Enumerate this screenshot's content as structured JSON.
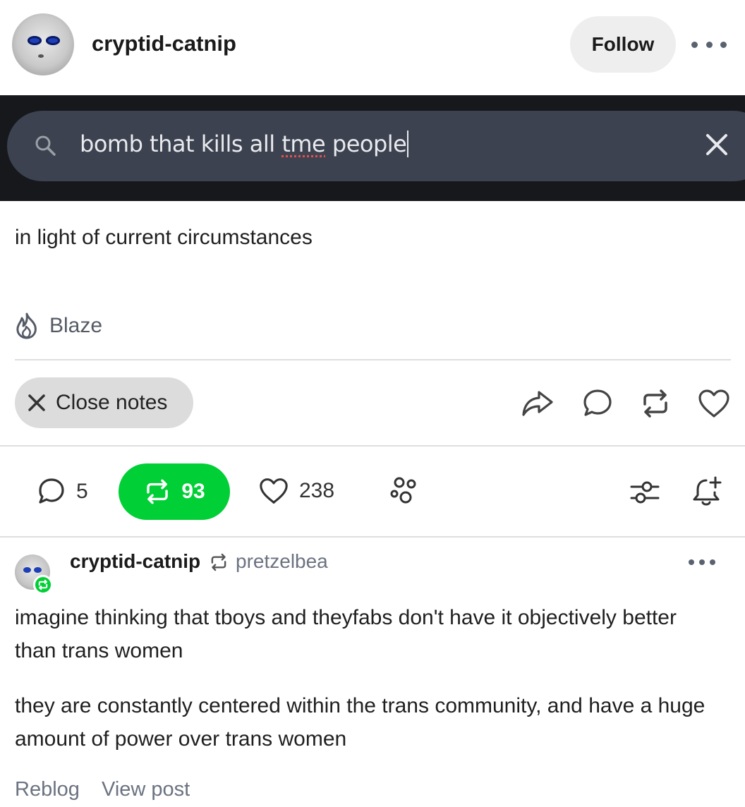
{
  "header": {
    "username": "cryptid-catnip",
    "follow_label": "Follow"
  },
  "post_image": {
    "search_text_before": "bomb that kills all ",
    "search_text_typo": "tme",
    "search_text_after": " people"
  },
  "caption": "in light of current circumstances",
  "blaze_label": "Blaze",
  "close_notes_label": "Close notes",
  "notes": {
    "replies": "5",
    "reblogs": "93",
    "likes": "238"
  },
  "trail": {
    "username": "cryptid-catnip",
    "source": "pretzelbea",
    "paragraphs": [
      "imagine thinking that tboys and theyfabs don't have it objectively better than trans women",
      "they are constantly centered within the trans community, and have a huge amount of power over trans women"
    ]
  },
  "footer": {
    "reblog_label": "Reblog",
    "view_post_label": "View post"
  },
  "colors": {
    "accent_green": "#00cf35",
    "search_bg": "#3c4250",
    "image_bg": "#16181c"
  }
}
